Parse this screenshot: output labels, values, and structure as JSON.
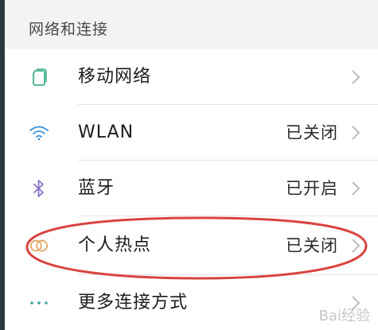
{
  "section": {
    "title": "网络和连接"
  },
  "rows": [
    {
      "label": "移动网络",
      "status": "",
      "icon": "sim-card-icon",
      "icon_color": "#3fae8c"
    },
    {
      "label": "WLAN",
      "status": "已关闭",
      "icon": "wifi-icon",
      "icon_color": "#3a8fd8"
    },
    {
      "label": "蓝牙",
      "status": "已开启",
      "icon": "bluetooth-icon",
      "icon_color": "#8a72c9"
    },
    {
      "label": "个人热点",
      "status": "已关闭",
      "icon": "hotspot-icon",
      "icon_color": "#e0a25a"
    },
    {
      "label": "更多连接方式",
      "status": "",
      "icon": "more-dots-icon",
      "icon_color": "#3aa6a0"
    }
  ],
  "colors": {
    "highlight": "#d9443f",
    "chevron": "#b5b5b5"
  },
  "watermark": "Bai经验"
}
